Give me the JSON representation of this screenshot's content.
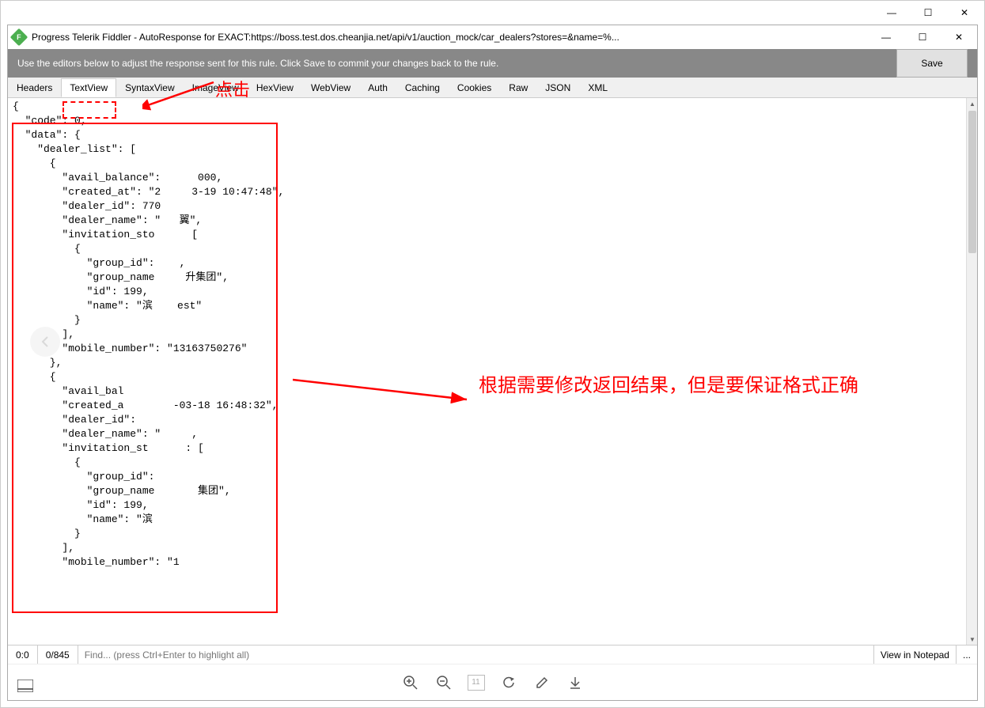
{
  "outer_window": {
    "minimize": "—",
    "maximize": "☐",
    "close": "✕"
  },
  "inner_window": {
    "title": "Progress Telerik Fiddler - AutoResponse for EXACT:https://boss.test.dos.cheanjia.net/api/v1/auction_mock/car_dealers?stores=&name=%...",
    "minimize": "—",
    "maximize": "☐",
    "close": "✕"
  },
  "graybar": {
    "hint": "Use the editors below to adjust the response sent for this rule. Click Save to commit your changes back to the rule.",
    "save": "Save"
  },
  "tabs": [
    {
      "label": "Headers",
      "selected": false
    },
    {
      "label": "TextView",
      "selected": true
    },
    {
      "label": "SyntaxView",
      "selected": false
    },
    {
      "label": "ImageView",
      "selected": false
    },
    {
      "label": "HexView",
      "selected": false
    },
    {
      "label": "WebView",
      "selected": false
    },
    {
      "label": "Auth",
      "selected": false
    },
    {
      "label": "Caching",
      "selected": false
    },
    {
      "label": "Cookies",
      "selected": false
    },
    {
      "label": "Raw",
      "selected": false
    },
    {
      "label": "JSON",
      "selected": false
    },
    {
      "label": "XML",
      "selected": false
    }
  ],
  "code_lines": [
    "{",
    "  \"code\": 0,",
    "  \"data\": {",
    "    \"dealer_list\": [",
    "      {",
    "        \"avail_balance\":      000,",
    "        \"created_at\": \"2     3-19 10:47:48\",",
    "        \"dealer_id\": 770   ",
    "        \"dealer_name\": \"   翼\",",
    "        \"invitation_sto      [",
    "          {",
    "            \"group_id\":    ,",
    "            \"group_name     升集团\",",
    "            \"id\": 199,",
    "            \"name\": \"滨    est\"",
    "          }",
    "        ],",
    "        \"mobile_number\": \"13163750276\"",
    "      },",
    "      {",
    "        \"avail_bal          ",
    "        \"created_a        -03-18 16:48:32\",",
    "        \"dealer_id\":       ",
    "        \"dealer_name\": \"     ,",
    "        \"invitation_st      : [",
    "          {",
    "            \"group_id\":      ",
    "            \"group_name       集团\",",
    "            \"id\": 199,",
    "            \"name\": \"滨      ",
    "          }",
    "        ],",
    "        \"mobile_number\": \"1           "
  ],
  "status": {
    "pos": "0:0",
    "range": "0/845",
    "find_placeholder": "Find... (press Ctrl+Enter to highlight all)",
    "notepad": "View in Notepad",
    "more": "..."
  },
  "bottom_toolbar": {
    "page_num": "11"
  },
  "annotations": {
    "click": "点击",
    "modify": "根据需要修改返回结果，但是要保证格式正确"
  }
}
